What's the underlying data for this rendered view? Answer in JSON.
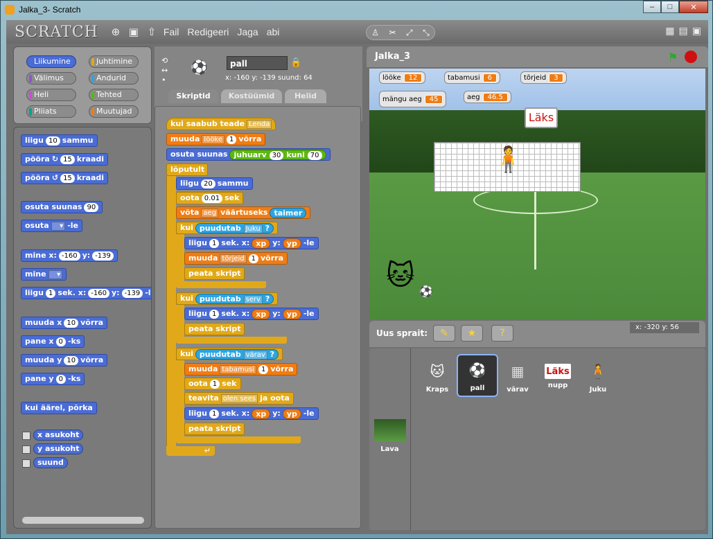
{
  "window": {
    "title": "Jalka_3- Scratch",
    "buttons": [
      "–",
      "□",
      "✕"
    ]
  },
  "menubar": {
    "logo": "SCRATCH",
    "items": [
      "Fail",
      "Redigeeri",
      "Jaga",
      "abi"
    ]
  },
  "categories": [
    {
      "label": "Liikumine",
      "color": "#4a6cd4"
    },
    {
      "label": "Juhtimine",
      "color": "#e1a91a"
    },
    {
      "label": "Välimus",
      "color": "#8a55d7"
    },
    {
      "label": "Andurid",
      "color": "#2ca5e2"
    },
    {
      "label": "Heli",
      "color": "#cf4ad9"
    },
    {
      "label": "Tehted",
      "color": "#5cb712"
    },
    {
      "label": "Pliiats",
      "color": "#00a48a"
    },
    {
      "label": "Muutujad",
      "color": "#ee7d16"
    }
  ],
  "palette": {
    "b1": "liigu",
    "b1n": "10",
    "b1t": "sammu",
    "b2": "pööra",
    "b2n": "15",
    "b2t": "kraadi",
    "b3": "pööra",
    "b3n": "15",
    "b3t": "kraadi",
    "b4": "osuta suunas",
    "b4n": "90",
    "b5": "osuta",
    "b5t": "-le",
    "b6": "mine x:",
    "b6x": "-160",
    "b6y": "y:",
    "b6yv": "-139",
    "b7": "mine",
    "b8": "liigu",
    "b8n": "1",
    "b8t": "sek. x:",
    "b8x": "-160",
    "b8y": "y:",
    "b8yv": "-139",
    "b8e": "-le",
    "b9": "muuda x",
    "b9n": "10",
    "b9t": "võrra",
    "b10": "pane x",
    "b10n": "0",
    "b10t": "-ks",
    "b11": "muuda y",
    "b11n": "10",
    "b11t": "võrra",
    "b12": "pane y",
    "b12n": "0",
    "b12t": "-ks",
    "b13": "kui äärel, põrka",
    "r1": "x asukoht",
    "r2": "y asukoht",
    "r3": "suund"
  },
  "sprite": {
    "name": "pall",
    "coords": "x: -160  y: -139  suund: 64"
  },
  "tabs": [
    "Skriptid",
    "Kostüümid",
    "Helid"
  ],
  "script": {
    "hat": "kui saabub teade",
    "hat_msg": "Lenda",
    "s1": "muuda",
    "s1v": "lööke",
    "s1n": "1",
    "s1t": "võrra",
    "s2": "osuta suunas",
    "s2op": "juhuarv",
    "s2a": "30",
    "s2k": "kuni",
    "s2b": "70",
    "loop": "lõputult",
    "s3": "liigu",
    "s3n": "20",
    "s3t": "sammu",
    "s4": "oota",
    "s4n": "0.01",
    "s4t": "sek",
    "s5": "võta",
    "s5v": "aeg",
    "s5t": "väärtuseks",
    "s5s": "taimer",
    "if1": "kui",
    "if1s": "puudutab",
    "if1v": "Juku",
    "q": "?",
    "s6": "liigu",
    "s6n": "1",
    "s6t": "sek. x:",
    "s6x": "xp",
    "s6y": "y:",
    "s6yv": "yp",
    "s6e": "-le",
    "s7": "muuda",
    "s7v": "tõrjeid",
    "s7n": "1",
    "s7t": "võrra",
    "s8": "peata skript",
    "if2": "kui",
    "if2s": "puudutab",
    "if2v": "serv",
    "s9": "liigu",
    "s9n": "1",
    "s9t": "sek. x:",
    "s9x": "xp",
    "s9y": "y:",
    "s9yv": "yp",
    "s9e": "-le",
    "s10": "peata skript",
    "if3": "kui",
    "if3s": "puudutab",
    "if3v": "värav",
    "s11": "muuda",
    "s11v": "tabamusi",
    "s11n": "1",
    "s11t": "võrra",
    "s12": "oota",
    "s12n": "1",
    "s12t": "sek",
    "s13": "teavita",
    "s13v": "olen sees",
    "s13t": "ja oota",
    "s14": "liigu",
    "s14n": "1",
    "s14t": "sek. x:",
    "s14x": "xp",
    "s14y": "y:",
    "s14yv": "yp",
    "s14e": "-le",
    "s15": "peata skript"
  },
  "stage": {
    "title": "Jalka_3",
    "monitors": [
      {
        "label": "lööke",
        "value": "12"
      },
      {
        "label": "tabamusi",
        "value": "6"
      },
      {
        "label": "tõrjeid",
        "value": "3"
      },
      {
        "label": "mängu aeg",
        "value": "45"
      },
      {
        "label": "aeg",
        "value": "46.5"
      }
    ],
    "laks": "Läks",
    "mouse": "x: -320   y: 56"
  },
  "newsprite": {
    "label": "Uus sprait:"
  },
  "sprites": [
    {
      "name": "Kraps",
      "icon": "🐱"
    },
    {
      "name": "pall",
      "icon": "⚽"
    },
    {
      "name": "värav",
      "icon": "▦"
    },
    {
      "name": "nupp",
      "icon": "Läks"
    },
    {
      "name": "Juku",
      "icon": "🧍"
    }
  ],
  "stagethumb": {
    "label": "Lava"
  }
}
